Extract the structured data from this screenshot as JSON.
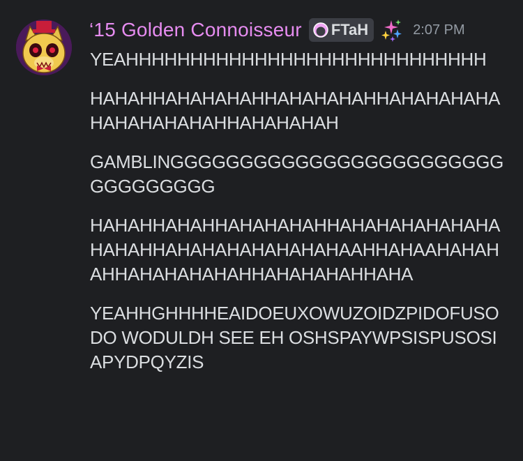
{
  "message": {
    "author": "‘15 Golden Connoisseur",
    "tag": {
      "label": "FTaH",
      "icon": "guild-tag-crescent-icon"
    },
    "badge_icon": "sparkle-stars-icon",
    "timestamp": "2:07 PM",
    "avatar_icon": "golden-freddy-avatar",
    "paragraphs": [
      "YEAHHHHHHHHHHHHHHHHHHHHHHHHHHHH",
      "HAHAHHAHAHAHAHHAHAHAHAHHAHAHAHAHAHAHAHAHAHAHHAHAHAHAH",
      "GAMBLINGGGGGGGGGGGGGGGGGGGGGGGGGGGGGGGGG",
      "HAHAHHAHAHHAHAHAHAHHAHAHAHAHAHAHAHAHAHHAHAHAHAHAHAHAHAAHHAHAAHAHAHAHHAHAHAHAHAHHAHAHAHAHHAHA",
      "YEAHHGHHHHEAIDOEUXOWUZOIDZPIDOFUSO DO WODULDH SEE EH OSHSPAYWPSISPUSOSIAPYDPQYZIS"
    ]
  },
  "colors": {
    "background": "#1e1f22",
    "username": "#e68cf0",
    "text": "#dbdee1",
    "timestamp": "#949ba4",
    "tag_bg": "#3b3d44"
  }
}
